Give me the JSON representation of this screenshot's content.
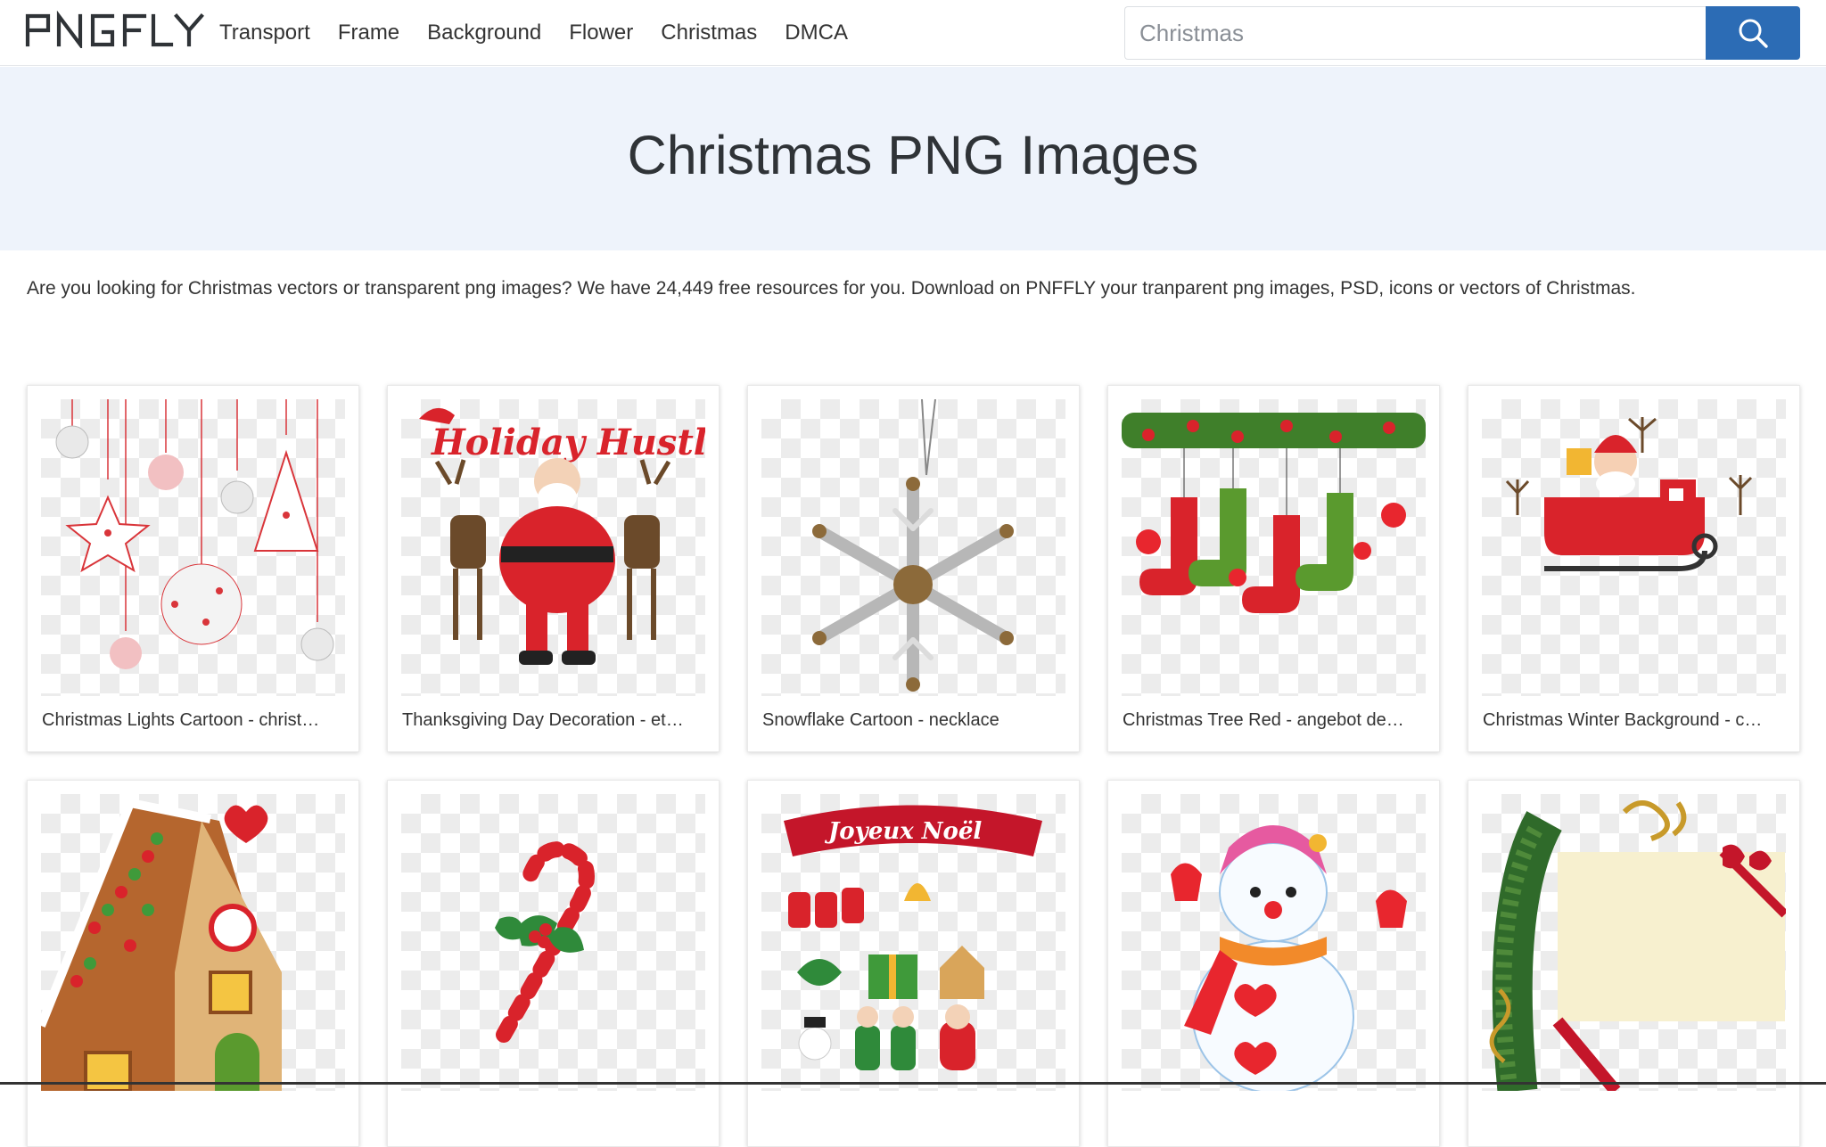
{
  "brand": {
    "logo_text": "PNGFLY",
    "accent_color": "#2c6cb5"
  },
  "nav": {
    "links": [
      "Transport",
      "Frame",
      "Background",
      "Flower",
      "Christmas",
      "DMCA"
    ]
  },
  "search": {
    "placeholder": "Christmas",
    "button_icon": "search-icon"
  },
  "hero": {
    "title": "Christmas PNG Images"
  },
  "intro": "Are you looking for Christmas vectors or transparent png images? We have 24,449 free resources for you. Download on PNFFLY your tranparent png images, PSD, icons or vectors of Christmas.",
  "cards": [
    {
      "title": "Christmas Lights Cartoon - christ…",
      "image": "hanging-snowflake-ornaments"
    },
    {
      "title": "Thanksgiving Day Decoration - et…",
      "image": "holiday-hustle-santa-reindeer"
    },
    {
      "title": "Snowflake Cartoon - necklace",
      "image": "snowflake-necklace"
    },
    {
      "title": "Christmas Tree Red - angebot de…",
      "image": "christmas-stockings"
    },
    {
      "title": "Christmas Winter Background - c…",
      "image": "santa-sleigh"
    },
    {
      "title": "",
      "image": "gingerbread-house"
    },
    {
      "title": "",
      "image": "candy-cane"
    },
    {
      "title": "",
      "image": "joyeux-noel-stickers"
    },
    {
      "title": "",
      "image": "snowman"
    },
    {
      "title": "",
      "image": "christmas-card-frame"
    }
  ],
  "image_text": {
    "holiday_hustle": "Holiday Hustle",
    "joyeux_noel": "Joyeux Noël"
  }
}
